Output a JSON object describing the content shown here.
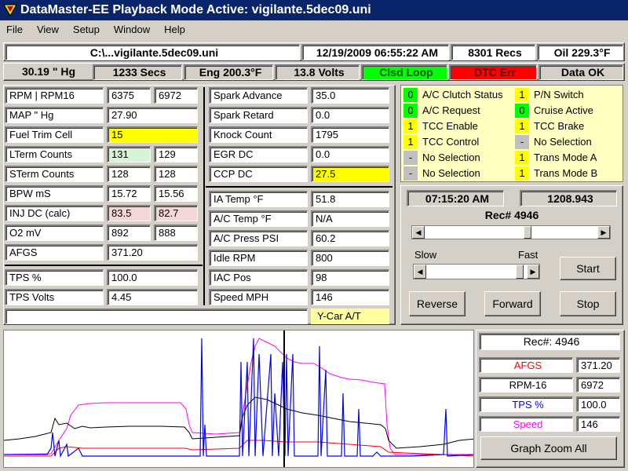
{
  "title": "DataMaster-EE  Playback Mode Active: vigilante.5dec09.uni",
  "menu": [
    "File",
    "View",
    "Setup",
    "Window",
    "Help"
  ],
  "status1": {
    "file": "C:\\...vigilante.5dec09.uni",
    "datetime": "12/19/2009   06:55:22 AM",
    "recs": "8301 Recs",
    "oil": "Oil  229.3°F"
  },
  "status2": {
    "baro": "30.19  \" Hg",
    "secs": "1233 Secs",
    "eng": "Eng  200.3°F",
    "volts": "13.8 Volts",
    "loop": "Clsd Loop",
    "dtc": "DTC Err",
    "data": "Data OK"
  },
  "colors": {
    "loop": "#00ff00",
    "dtc": "#ff0000",
    "highlight": "#ffff00"
  },
  "left": [
    {
      "label": "RPM   |  RPM16",
      "v1": "6375",
      "v2": "6972"
    },
    {
      "label": "MAP  \" Hg",
      "v1": "27.90"
    },
    {
      "label": "Fuel Trim Cell",
      "v1": "15"
    },
    {
      "label": "LTerm Counts",
      "v1": "131",
      "v2": "129"
    },
    {
      "label": "STerm Counts",
      "v1": "128",
      "v2": "128"
    },
    {
      "label": "BPW  mS",
      "v1": "15.72",
      "v2": "15.56"
    },
    {
      "label": "INJ DC (calc)",
      "v1": "83.5",
      "v2": "82.7"
    },
    {
      "label": "O2 mV",
      "v1": "892",
      "v2": "888"
    },
    {
      "label": "AFGS",
      "v1": "371.20"
    },
    {
      "label": "TPS %",
      "v1": "100.0"
    },
    {
      "label": "TPS Volts",
      "v1": "4.45"
    }
  ],
  "mid": [
    {
      "label": "Spark Advance",
      "v": "35.0"
    },
    {
      "label": "Spark Retard",
      "v": "0.0"
    },
    {
      "label": "Knock Count",
      "v": "1795"
    },
    {
      "label": "EGR DC",
      "v": "0.0"
    },
    {
      "label": "CCP DC",
      "v": "27.5"
    },
    {
      "label": "IA Temp °F",
      "v": "51.8"
    },
    {
      "label": "A/C Temp °F",
      "v": "N/A"
    },
    {
      "label": "A/C Press PSI",
      "v": "60.2"
    },
    {
      "label": "Idle RPM",
      "v": "800"
    },
    {
      "label": "IAC Pos",
      "v": "98"
    },
    {
      "label": "Speed MPH",
      "v": "146"
    }
  ],
  "car_type": "Y-Car A/T",
  "status_left": [
    {
      "ind": "0",
      "text": "A/C Clutch Status",
      "color": "#00ff00"
    },
    {
      "ind": "0",
      "text": "A/C Request",
      "color": "#00ff00"
    },
    {
      "ind": "1",
      "text": "TCC Enable",
      "color": "#ffff00"
    },
    {
      "ind": "1",
      "text": "TCC Control",
      "color": "#ffff00"
    },
    {
      "ind": "-",
      "text": "No Selection",
      "color": "#c0c0c0"
    },
    {
      "ind": "-",
      "text": "No Selection",
      "color": "#c0c0c0"
    }
  ],
  "status_right": [
    {
      "ind": "1",
      "text": "P/N Switch",
      "color": "#ffff00"
    },
    {
      "ind": "0",
      "text": "Cruise Active",
      "color": "#00ff00"
    },
    {
      "ind": "1",
      "text": "TCC Brake",
      "color": "#ffff00"
    },
    {
      "ind": "-",
      "text": "No Selection",
      "color": "#c0c0c0"
    },
    {
      "ind": "1",
      "text": "Trans Mode A",
      "color": "#ffff00"
    },
    {
      "ind": "1",
      "text": "Trans Mode B",
      "color": "#ffff00"
    }
  ],
  "playback": {
    "time": "07:15:20 AM",
    "elapsed": "1208.943",
    "rec": "Rec# 4946",
    "slow": "Slow",
    "fast": "Fast",
    "start": "Start",
    "reverse": "Reverse",
    "forward": "Forward",
    "stop": "Stop"
  },
  "graph_legend": {
    "rec": "Rec#:  4946",
    "items": [
      {
        "name": "AFGS",
        "value": "371.20",
        "color": "#ff0000"
      },
      {
        "name": "RPM-16",
        "value": "6972",
        "color": "#000000"
      },
      {
        "name": "TPS %",
        "value": "100.0",
        "color": "#0000ff"
      },
      {
        "name": "Speed",
        "value": "146",
        "color": "#ff00ff"
      }
    ],
    "zoom": "Graph Zoom All"
  }
}
